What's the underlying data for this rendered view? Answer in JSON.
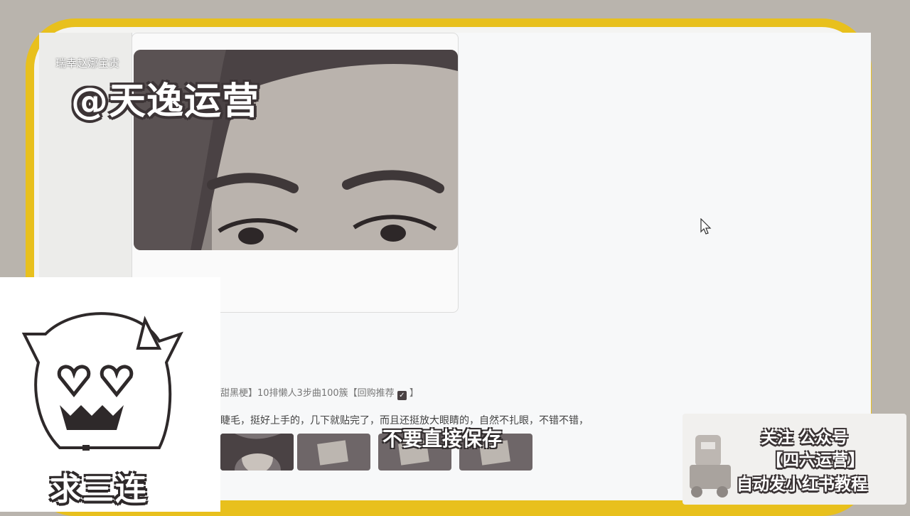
{
  "watermark": {
    "top_text": "瑞幸赵娜宝贵",
    "main_text": "@天逸运营"
  },
  "post": {
    "title_prefix": "甜黑梗】10排懒人3步曲100簇【回购推荐",
    "title_suffix": "】",
    "check_icon": "check-icon",
    "body": "睫毛，挺好上手的，几下就贴完了，而且还挺放大眼睛的，自然不扎眼，不错不错，"
  },
  "subtitle": "不要直接保存",
  "mascot": {
    "caption": "求三连"
  },
  "promo": {
    "line1": "关注 公众号",
    "line2": "【四六运营】",
    "line3": "自动发小红书教程"
  },
  "colors": {
    "accent_yellow": "#e8c01d",
    "background": "#b9b4ad",
    "outline_dark": "#3c3436"
  }
}
